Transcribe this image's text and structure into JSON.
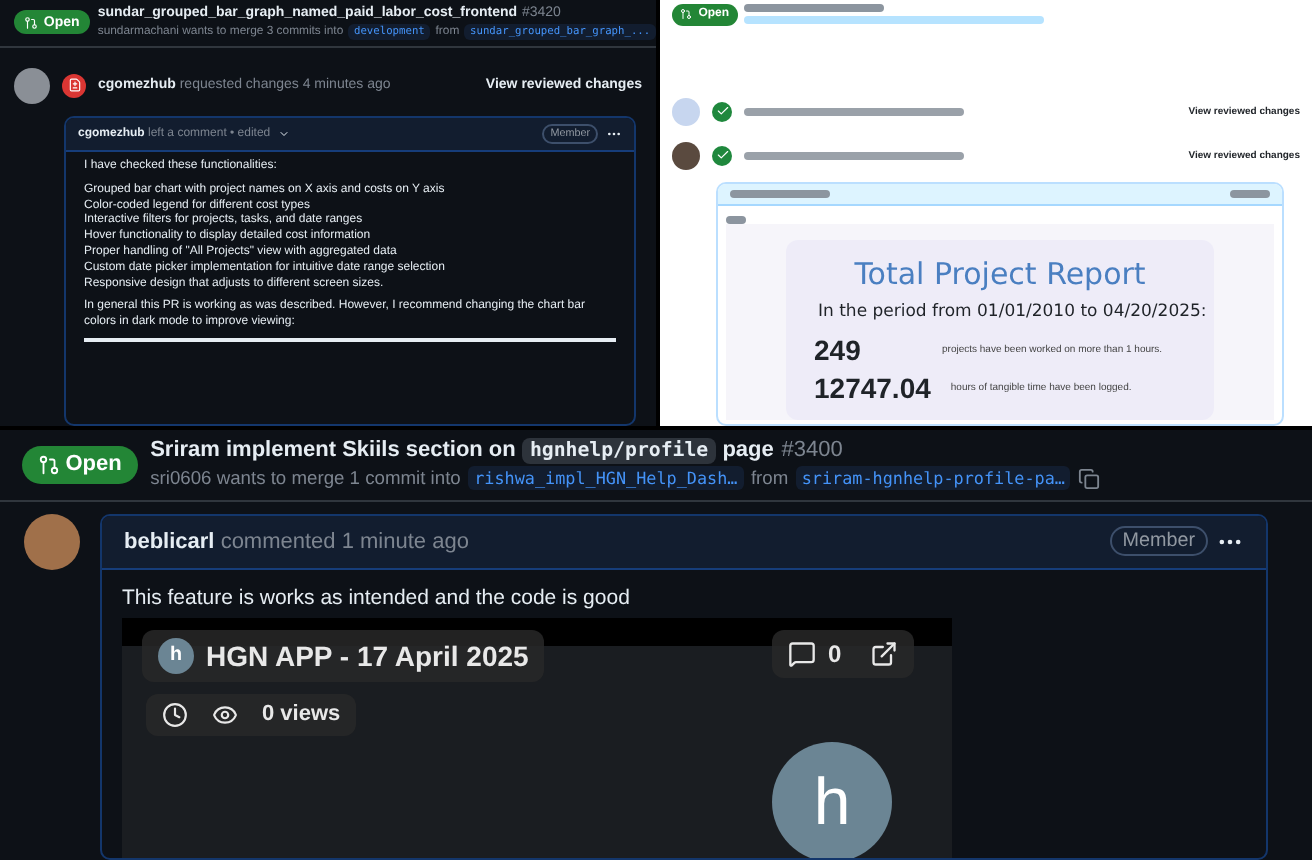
{
  "top_left_pr": {
    "status": "Open",
    "title": "sundar_grouped_bar_graph_named_paid_labor_cost_frontend",
    "number": "#3420",
    "merge": {
      "text": "sundarmachani wants to merge 3 commits into",
      "base": "development",
      "from": "from",
      "head": "sundar_grouped_bar_graph_..."
    },
    "review": {
      "kind": "changes",
      "user": "cgomezhub",
      "action": "requested changes 4 minutes ago",
      "link": "View reviewed changes"
    },
    "comment": {
      "user": "cgomezhub",
      "meta": "left a comment • edited",
      "role": "Member",
      "intro": "I have checked these functionalities:",
      "items": [
        "Grouped bar chart with project names on X axis and costs on Y axis",
        "Color-coded legend for different cost types",
        "Interactive filters for projects, tasks, and date ranges",
        "Hover functionality to display detailed cost information",
        "Proper handling of \"All Projects\" view with aggregated data",
        "Custom date picker implementation for intuitive date range selection",
        "Responsive design that adjusts to different screen sizes."
      ],
      "conclusion": "In general this PR is working as was described. However, I recommend changing the chart bar colors in dark mode to improve viewing:"
    }
  },
  "top_right_pr": {
    "status": "Open",
    "reviews": [
      {
        "kind": "approved",
        "link": "View reviewed changes"
      },
      {
        "kind": "approved",
        "link": "View reviewed changes"
      }
    ],
    "report": {
      "title": "Total Project Report",
      "period": "In the period from 01/01/2010 to 04/20/2025:",
      "stats": [
        {
          "value": "249",
          "text": "projects have been worked on more than 1 hours."
        },
        {
          "value": "12747.04",
          "text": "hours of tangible time have been logged."
        }
      ]
    }
  },
  "bottom_pr": {
    "status": "Open",
    "title_parts": [
      {
        "kind": "text",
        "text": "Sriram implement Skiils section on"
      },
      {
        "kind": "code",
        "text": "hgnhelp/profile"
      },
      {
        "kind": "text",
        "text": "page"
      }
    ],
    "number": "#3400",
    "merge": {
      "text": "sri0606 wants to merge 1 commit into",
      "base": "rishwa_impl_HGN_Help_Dash…",
      "from": "from",
      "head": "sriram-hgnhelp-profile-pa…"
    },
    "comment": {
      "user": "beblicarl",
      "meta": "commented 1 minute ago",
      "role": "Member",
      "body": "This feature is works as intended and the code is good",
      "video": {
        "title": "HGN APP - 17 April 2025",
        "avatar_letter": "h",
        "views": "0 views",
        "comments": "0",
        "big_letter": "h"
      }
    }
  }
}
